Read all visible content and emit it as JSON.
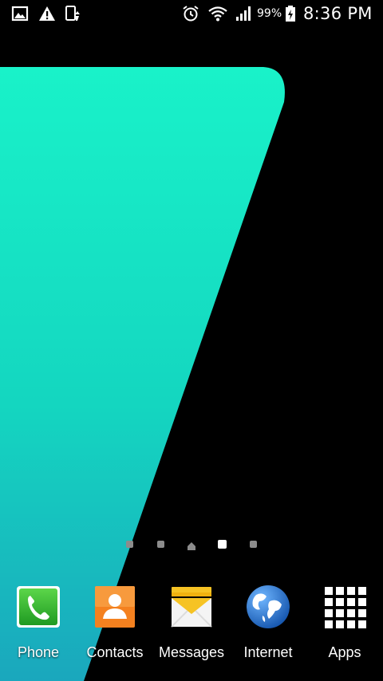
{
  "status_bar": {
    "left_icons": [
      "gallery-notification-icon",
      "warning-icon",
      "mobile-data-icon"
    ],
    "right_icons": [
      "alarm-icon",
      "wifi-icon",
      "signal-icon",
      "battery-icon"
    ],
    "battery_percent": "99%",
    "time": "8:36 PM"
  },
  "wallpaper": {
    "shape_color_top": "#19f0c8",
    "shape_color_bottom": "#1ab4bf",
    "background_color": "#000000"
  },
  "home_screens": {
    "pages": [
      "page",
      "page",
      "home",
      "page",
      "page"
    ],
    "active_index": 3
  },
  "dock": {
    "items": [
      {
        "label": "Phone",
        "icon": "phone-icon"
      },
      {
        "label": "Contacts",
        "icon": "contacts-icon"
      },
      {
        "label": "Messages",
        "icon": "messages-icon"
      },
      {
        "label": "Internet",
        "icon": "internet-globe-icon"
      },
      {
        "label": "Apps",
        "icon": "apps-grid-icon"
      }
    ]
  },
  "colors": {
    "phone_green": "#34b233",
    "contacts_orange": "#f4811f",
    "messages_yellow": "#f6c324",
    "internet_blue": "#1f6fd1"
  }
}
